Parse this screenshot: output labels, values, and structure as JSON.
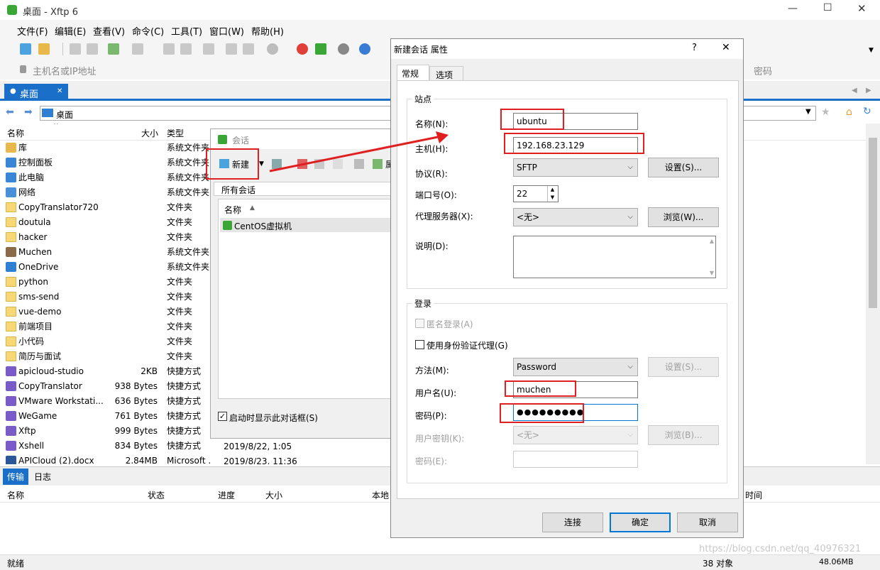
{
  "window": {
    "title": "桌面 - Xftp 6"
  },
  "menu": [
    "文件(F)",
    "编辑(E)",
    "查看(V)",
    "命令(C)",
    "工具(T)",
    "窗口(W)",
    "帮助(H)"
  ],
  "address_bar": {
    "placeholder": "主机名或IP地址",
    "password_placeholder": "密码"
  },
  "tab": {
    "label": "桌面"
  },
  "path": {
    "label": "桌面"
  },
  "columns": {
    "name": "名称",
    "size": "大小",
    "type": "类型"
  },
  "files": [
    {
      "name": "库",
      "size": "",
      "type": "系统文件夹",
      "icon": "library-icon"
    },
    {
      "name": "控制面板",
      "size": "",
      "type": "系统文件夹",
      "icon": "control-panel-icon"
    },
    {
      "name": "此电脑",
      "size": "",
      "type": "系统文件夹",
      "icon": "computer-icon"
    },
    {
      "name": "网络",
      "size": "",
      "type": "系统文件夹",
      "icon": "network-icon"
    },
    {
      "name": "CopyTranslator720",
      "size": "",
      "type": "文件夹",
      "icon": "folder-icon"
    },
    {
      "name": "doutula",
      "size": "",
      "type": "文件夹",
      "icon": "folder-icon"
    },
    {
      "name": "hacker",
      "size": "",
      "type": "文件夹",
      "icon": "folder-icon"
    },
    {
      "name": "Muchen",
      "size": "",
      "type": "系统文件夹",
      "icon": "user-icon"
    },
    {
      "name": "OneDrive",
      "size": "",
      "type": "系统文件夹",
      "icon": "cloud-icon"
    },
    {
      "name": "python",
      "size": "",
      "type": "文件夹",
      "icon": "folder-icon"
    },
    {
      "name": "sms-send",
      "size": "",
      "type": "文件夹",
      "icon": "folder-icon"
    },
    {
      "name": "vue-demo",
      "size": "",
      "type": "文件夹",
      "icon": "folder-icon"
    },
    {
      "name": "前端项目",
      "size": "",
      "type": "文件夹",
      "icon": "folder-icon"
    },
    {
      "name": "小代码",
      "size": "",
      "type": "文件夹",
      "icon": "folder-icon"
    },
    {
      "name": "简历与面试",
      "size": "",
      "type": "文件夹",
      "icon": "folder-icon"
    },
    {
      "name": "apicloud-studio",
      "size": "2KB",
      "type": "快捷方式",
      "icon": "shortcut-icon"
    },
    {
      "name": "CopyTranslator",
      "size": "938 Bytes",
      "type": "快捷方式",
      "icon": "shortcut-icon"
    },
    {
      "name": "VMware Workstati...",
      "size": "636 Bytes",
      "type": "快捷方式",
      "icon": "shortcut-icon"
    },
    {
      "name": "WeGame",
      "size": "761 Bytes",
      "type": "快捷方式",
      "icon": "shortcut-icon"
    },
    {
      "name": "Xftp",
      "size": "999 Bytes",
      "type": "快捷方式",
      "icon": "shortcut-icon"
    },
    {
      "name": "Xshell",
      "size": "834 Bytes",
      "type": "快捷方式",
      "icon": "shortcut-icon"
    },
    {
      "name": "APICloud (2).docx",
      "size": "2.84MB",
      "type": "Microsoft ...",
      "icon": "word-icon"
    }
  ],
  "dates": [
    "2019/8/22, 1:05",
    "2019/8/23, 11:36"
  ],
  "session_dialog": {
    "title": "会话",
    "new_label": "新建",
    "all_sessions": "所有会话",
    "column_name": "名称",
    "items": [
      "CentOS虚拟机"
    ],
    "startup_checkbox": "启动时显示此对话框(S)",
    "toolbar_cut_label": "属"
  },
  "props_dialog": {
    "title": "新建会话 属性",
    "help": "?",
    "close": "✕",
    "tabs": [
      "常规",
      "选项"
    ],
    "site_group": "站点",
    "name_label": "名称(N):",
    "name_value": "ubuntu",
    "host_label": "主机(H):",
    "host_value": "192.168.23.129",
    "protocol_label": "协议(R):",
    "protocol_value": "SFTP",
    "settings_btn": "设置(S)...",
    "port_label": "端口号(O):",
    "port_value": "22",
    "proxy_label": "代理服务器(X):",
    "proxy_value": "<无>",
    "browse_btn": "浏览(W)...",
    "desc_label": "说明(D):",
    "login_group": "登录",
    "anon_label": "匿名登录(A)",
    "agent_label": "使用身份验证代理(G)",
    "method_label": "方法(M):",
    "method_value": "Password",
    "method_settings_btn": "设置(S)...",
    "user_label": "用户名(U):",
    "user_value": "muchen",
    "pass_label": "密码(P):",
    "pass_value": "●●●●●●●●●",
    "userkey_label": "用户密钥(K):",
    "userkey_value": "<无>",
    "userkey_browse_btn": "浏览(B)...",
    "passphrase_label": "密码(E):",
    "connect_btn": "连接",
    "ok_btn": "确定",
    "cancel_btn": "取消"
  },
  "bottom_tabs": [
    "传输",
    "日志"
  ],
  "transfer_columns": [
    "名称",
    "状态",
    "进度",
    "大小",
    "本地",
    "时间"
  ],
  "status": {
    "left": "就绪",
    "objects": "38 对象",
    "size": "48.06MB",
    "watermark": "https://blog.csdn.net/qq_40976321"
  }
}
